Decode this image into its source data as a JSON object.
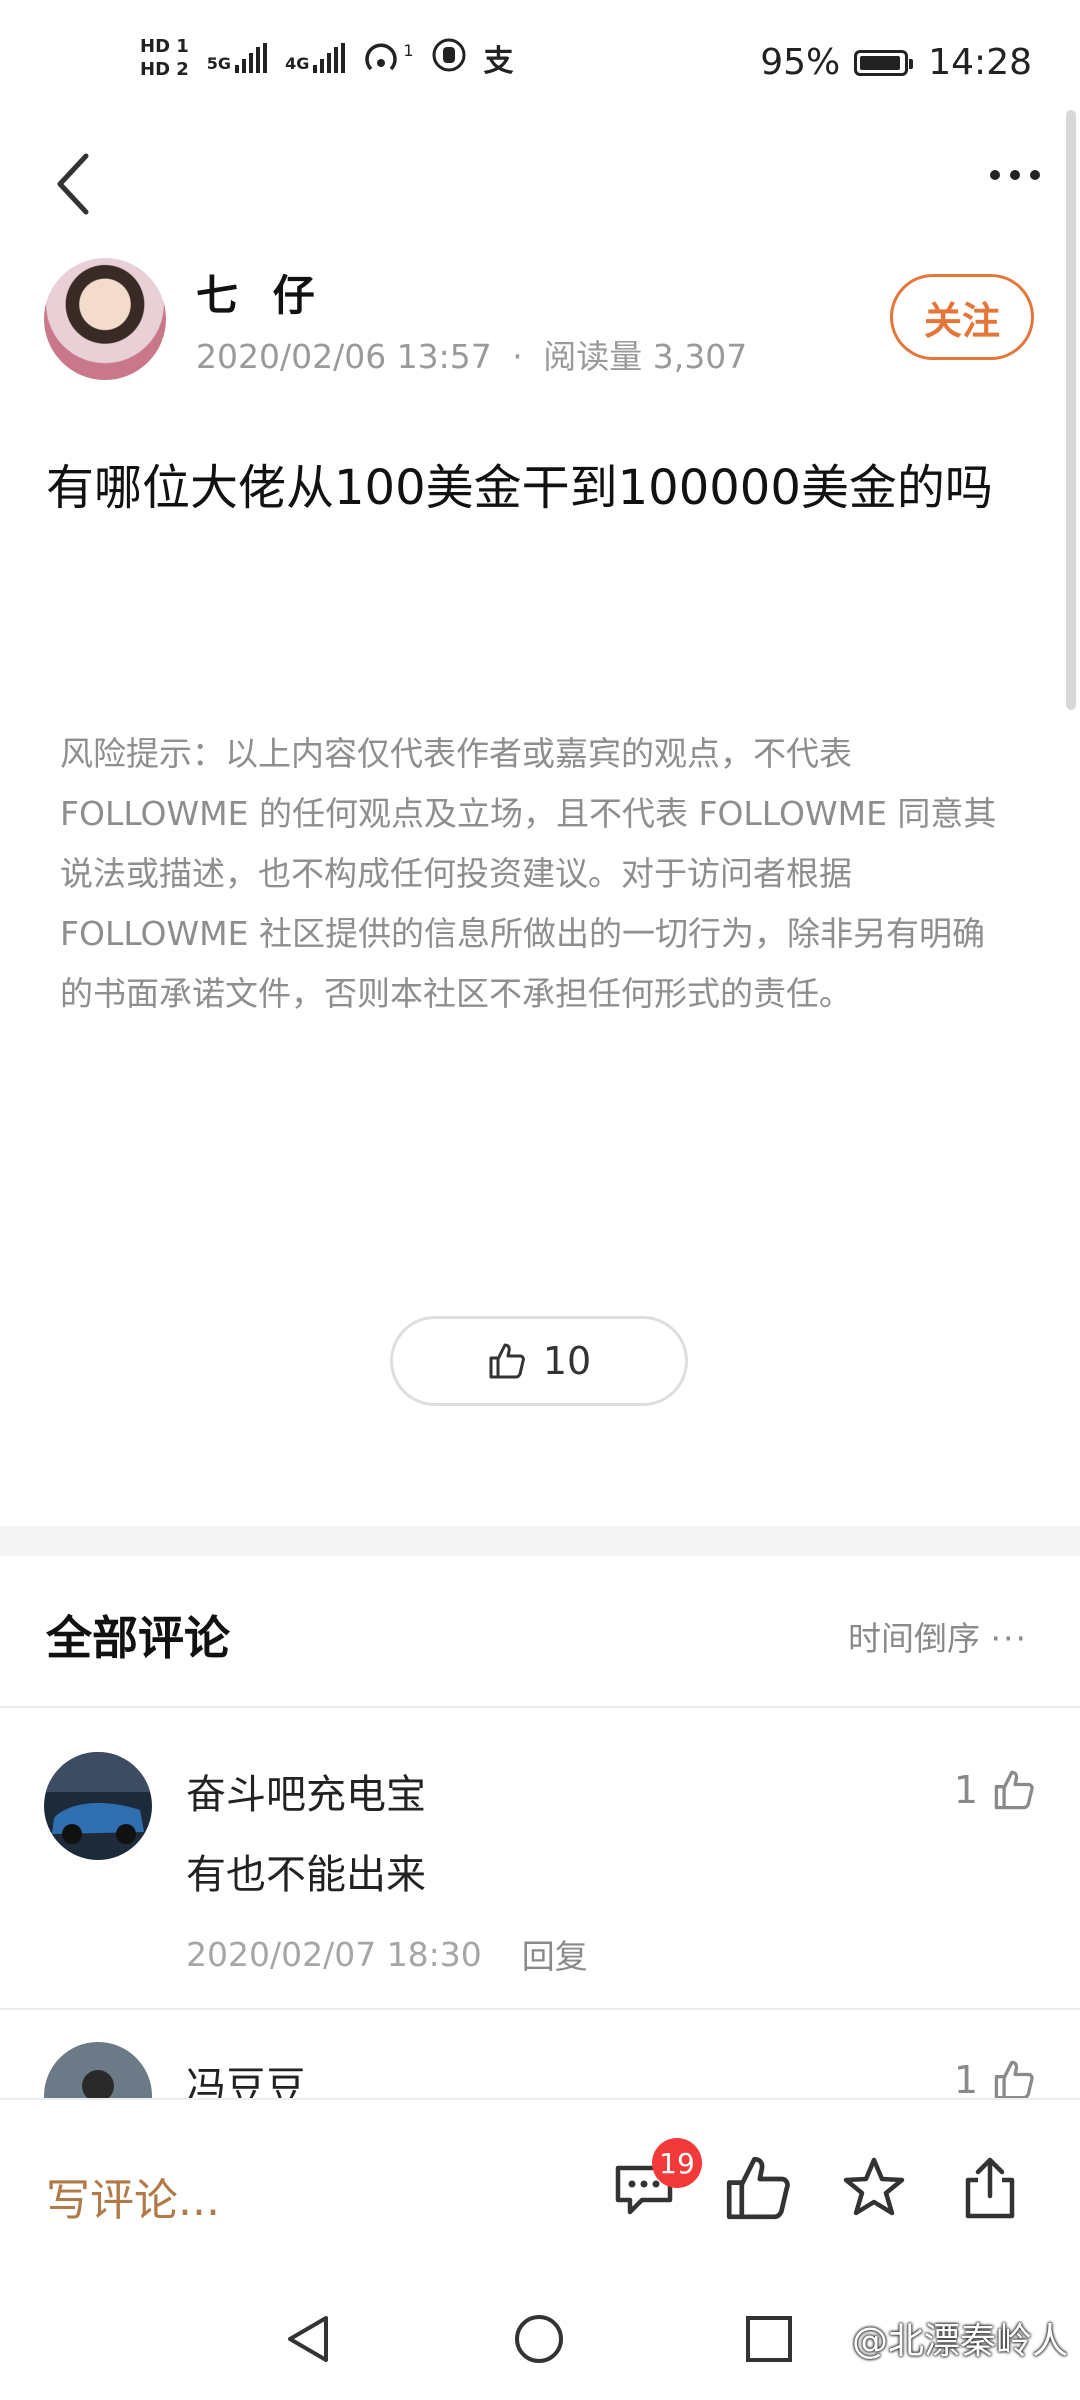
{
  "status_bar": {
    "sim1": "HD 1",
    "sim2": "HD 2",
    "net1": "5G",
    "net2": "4G",
    "hotspot_count": "1",
    "battery": "95%",
    "battery_level": 0.95,
    "time": "14:28"
  },
  "post": {
    "author": "七 仔",
    "date": "2020/02/06 13:57",
    "separator": "·",
    "views_label": "阅读量 3,307",
    "follow_label": "关注",
    "title": "有哪位大佬从100美金干到100000美金的吗",
    "risk_notice": "风险提示：以上内容仅代表作者或嘉宾的观点，不代表 FOLLOWME 的任何观点及立场，且不代表 FOLLOWME 同意其说法或描述，也不构成任何投资建议。对于访问者根据 FOLLOWME 社区提供的信息所做出的一切行为，除非另有明确的书面承诺文件，否则本社区不承担任何形式的责任。",
    "like_count": "10"
  },
  "comments_section": {
    "title": "全部评论",
    "sort_label": "时间倒序",
    "items": [
      {
        "name": "奋斗吧充电宝",
        "text": "有也不能出来",
        "time": "2020/02/07 18:30",
        "reply_label": "回复",
        "likes": "1"
      },
      {
        "name": "冯豆豆",
        "likes": "1"
      }
    ]
  },
  "bottom_bar": {
    "write_placeholder": "写评论...",
    "comment_badge": "19"
  },
  "watermark": "@北漂秦岭人",
  "colors": {
    "accent": "#e5763a",
    "badge": "#f23a3a",
    "write_text": "#b07a4a",
    "meta_gray": "#9a9a9a"
  },
  "icons": [
    "back-arrow-icon",
    "more-icon",
    "thumb-up-icon",
    "comment-icon",
    "star-icon",
    "share-icon",
    "nav-back-icon",
    "nav-home-icon",
    "nav-recent-icon"
  ]
}
